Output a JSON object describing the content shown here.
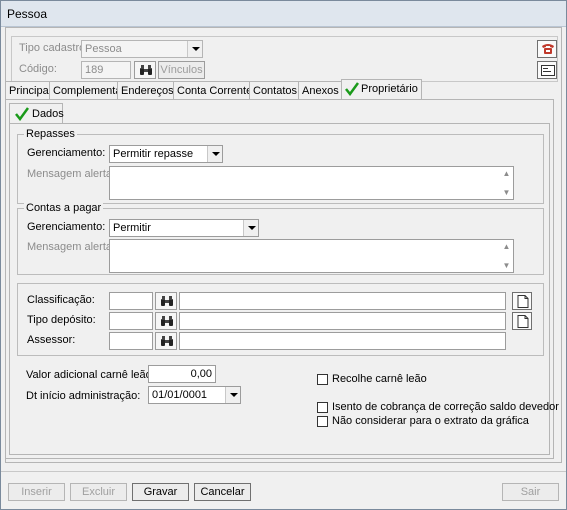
{
  "window": {
    "title": "Pessoa"
  },
  "header": {
    "tipo_cadastro_label": "Tipo cadastro",
    "tipo_cadastro_value": "Pessoa",
    "codigo_label": "Código:",
    "codigo_value": "189",
    "vinculos_label": "Vínculos"
  },
  "tabs": [
    {
      "label": "Principal"
    },
    {
      "label": "Complementar"
    },
    {
      "label": "Endereços"
    },
    {
      "label": "Conta Corrente"
    },
    {
      "label": "Contatos"
    },
    {
      "label": "Anexos"
    },
    {
      "label": "Proprietário",
      "active": true
    }
  ],
  "subtab": {
    "label": "Dados"
  },
  "repasses": {
    "legend": "Repasses",
    "gerenciamento_label": "Gerenciamento:",
    "gerenciamento_value": "Permitir repasse",
    "mensagem_label": "Mensagem alerta:",
    "mensagem_value": ""
  },
  "contas": {
    "legend": "Contas a pagar",
    "gerenciamento_label": "Gerenciamento:",
    "gerenciamento_value": "Permitir",
    "mensagem_label": "Mensagem alerta:",
    "mensagem_value": ""
  },
  "lookups": {
    "classificacao_label": "Classificação:",
    "tipo_deposito_label": "Tipo depósito:",
    "assessor_label": "Assessor:"
  },
  "extra": {
    "valor_label": "Valor adicional carnê leão:",
    "valor_value": "0,00",
    "dt_label": "Dt início administração:",
    "dt_value": "01/01/0001",
    "recolhe_label": "Recolhe carnê leão",
    "isento_label": "Isento de cobrança de correção saldo devedor",
    "nao_considerar_label": "Não considerar para o extrato da gráfica"
  },
  "footer": {
    "inserir": "Inserir",
    "excluir": "Excluir",
    "gravar": "Gravar",
    "cancelar": "Cancelar",
    "sair": "Sair"
  },
  "colors": {
    "check_green": "#1a9a1a",
    "phone_red": "#c0392b"
  }
}
